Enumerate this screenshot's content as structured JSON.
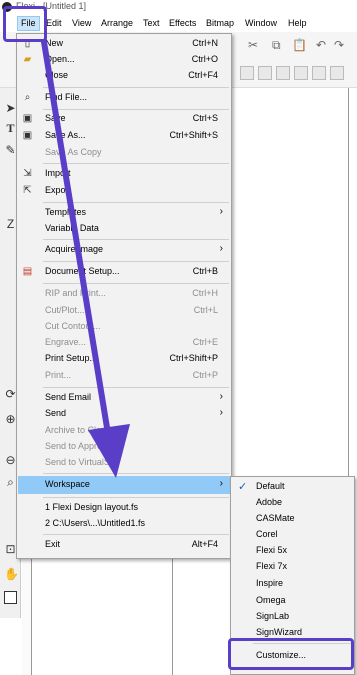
{
  "window": {
    "title": "Flexi - [Untitled 1]"
  },
  "menubar": {
    "items": [
      "File",
      "Edit",
      "View",
      "Arrange",
      "Text",
      "Effects",
      "Bitmap",
      "Window",
      "Help"
    ]
  },
  "file_menu": {
    "items": [
      {
        "label": "New",
        "shortcut": "Ctrl+N",
        "icon": "new-doc-icon"
      },
      {
        "label": "Open...",
        "shortcut": "Ctrl+O",
        "icon": "open-folder-icon"
      },
      {
        "label": "Close",
        "shortcut": "Ctrl+F4",
        "icon": ""
      },
      {
        "label": "Find File...",
        "shortcut": "",
        "icon": "find-file-icon"
      },
      {
        "label": "Save",
        "shortcut": "Ctrl+S",
        "icon": "save-icon"
      },
      {
        "label": "Save As...",
        "shortcut": "Ctrl+Shift+S",
        "icon": "save-as-icon"
      },
      {
        "label": "Save As Copy",
        "shortcut": "",
        "icon": ""
      },
      {
        "label": "Import",
        "shortcut": "",
        "icon": "import-icon"
      },
      {
        "label": "Export",
        "shortcut": "",
        "icon": "export-icon"
      },
      {
        "label": "Templates",
        "shortcut": "",
        "icon": ""
      },
      {
        "label": "Variable Data",
        "shortcut": "",
        "icon": ""
      },
      {
        "label": "Acquire Image",
        "shortcut": "",
        "icon": ""
      },
      {
        "label": "Document Setup...",
        "shortcut": "Ctrl+B",
        "icon": "document-setup-icon"
      },
      {
        "label": "RIP and Print...",
        "shortcut": "Ctrl+H",
        "icon": ""
      },
      {
        "label": "Cut/Plot...",
        "shortcut": "Ctrl+L",
        "icon": ""
      },
      {
        "label": "Cut Contour...",
        "shortcut": "",
        "icon": ""
      },
      {
        "label": "Engrave...",
        "shortcut": "Ctrl+E",
        "icon": ""
      },
      {
        "label": "Print Setup...",
        "shortcut": "Ctrl+Shift+P",
        "icon": ""
      },
      {
        "label": "Print...",
        "shortcut": "Ctrl+P",
        "icon": ""
      },
      {
        "label": "Send Email",
        "shortcut": "",
        "icon": ""
      },
      {
        "label": "Send",
        "shortcut": "",
        "icon": ""
      },
      {
        "label": "Archive to Cloud",
        "shortcut": "",
        "icon": ""
      },
      {
        "label": "Send to Approve...",
        "shortcut": "",
        "icon": ""
      },
      {
        "label": "Send to VirtualSi...",
        "shortcut": "",
        "icon": ""
      },
      {
        "label": "Workspace",
        "shortcut": "",
        "icon": ""
      },
      {
        "label": "1 Flexi Design layout.fs",
        "shortcut": "",
        "icon": ""
      },
      {
        "label": "2 C:\\Users\\...\\Untitled1.fs",
        "shortcut": "",
        "icon": ""
      },
      {
        "label": "Exit",
        "shortcut": "Alt+F4",
        "icon": ""
      }
    ],
    "submenu_arrow": "›"
  },
  "workspace_submenu": {
    "items": [
      "Default",
      "Adobe",
      "CASMate",
      "Corel",
      "Flexi 5x",
      "Flexi 7x",
      "Inspire",
      "Omega",
      "SignLab",
      "SignWizard",
      "Customize..."
    ],
    "checked": "Default",
    "check_glyph": "✓"
  },
  "colors": {
    "annotation": "#5b3ec8",
    "highlight": "#91c9f7",
    "disabled_text": "#8d8d8d"
  }
}
